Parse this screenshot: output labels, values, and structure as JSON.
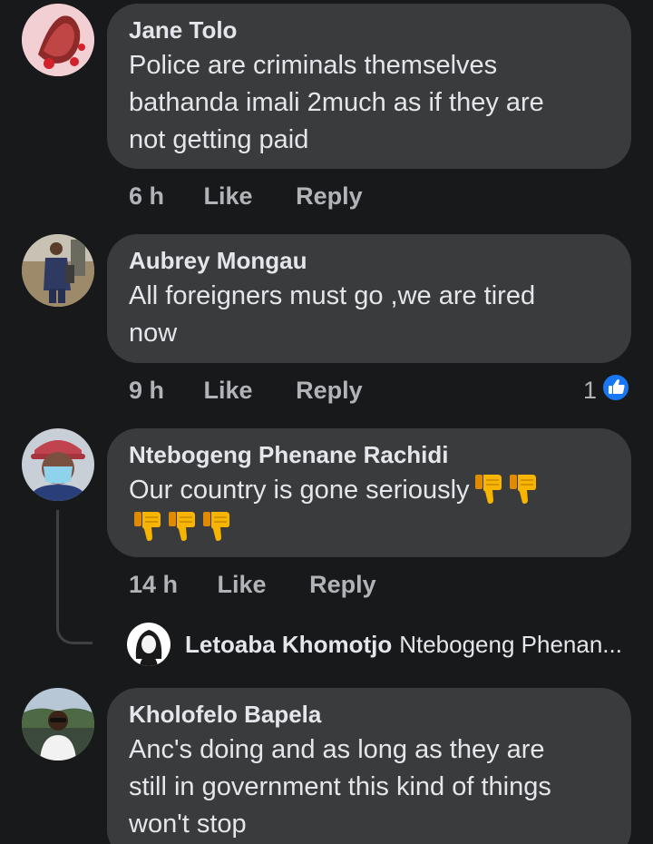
{
  "comments": [
    {
      "author": "Jane Tolo",
      "lines": [
        "Police are criminals themselves",
        "bathanda imali 2much as if they are",
        "not getting paid"
      ],
      "time": "6 h",
      "like_label": "Like",
      "reply_label": "Reply"
    },
    {
      "author": "Aubrey Mongau",
      "lines": [
        "All foreigners must go ,we are tired",
        "now"
      ],
      "time": "9 h",
      "like_label": "Like",
      "reply_label": "Reply",
      "reaction_count": "1",
      "reaction_icon": "like-reaction-icon"
    },
    {
      "author": "Ntebogeng Phenane Rachidi",
      "lines": [
        "Our country is gone seriously"
      ],
      "emoji": "thumbs-down",
      "emoji_count": 5,
      "time": "14 h",
      "like_label": "Like",
      "reply_label": "Reply",
      "reply": {
        "author": "Letoaba Khomotjo",
        "preview": "Ntebogeng Phenan..."
      }
    },
    {
      "author": "Kholofelo Bapela",
      "lines": [
        "Anc's doing and as long as they are",
        "still in government this kind of things",
        "won't stop"
      ]
    }
  ],
  "colors": {
    "background": "#18191a",
    "bubble": "#3a3b3c",
    "text": "#e4e6eb",
    "secondary_text": "#b0b3b8",
    "like_blue": "#1877f2",
    "emoji_yellow": "#f7b500"
  }
}
